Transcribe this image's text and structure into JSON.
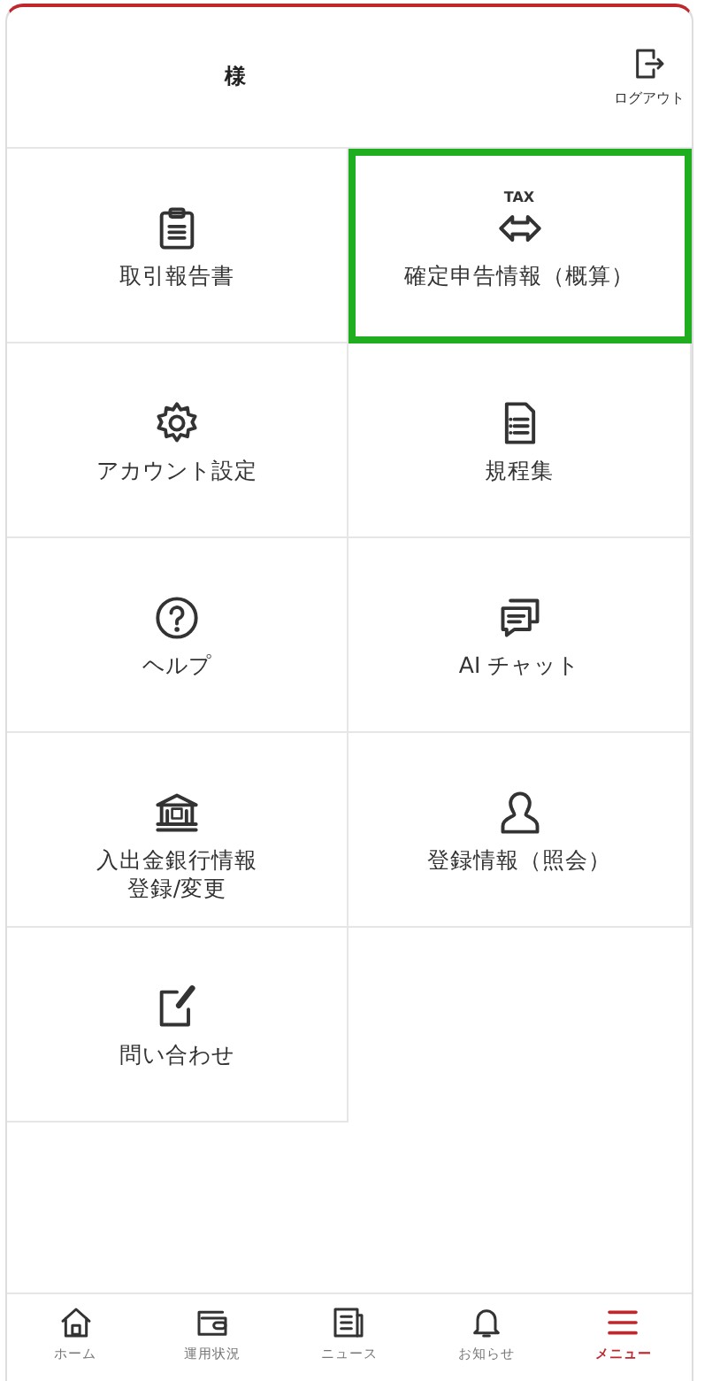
{
  "header": {
    "user_suffix": "様",
    "logout_label": "ログアウト"
  },
  "menu_rows": [
    [
      {
        "label": "取引報告書",
        "highlighted": false
      },
      {
        "label": "確定申告情報（概算）",
        "icon_text": "TAX",
        "highlighted": true
      }
    ],
    [
      {
        "label": "アカウント設定",
        "highlighted": false
      },
      {
        "label": "規程集",
        "highlighted": false
      }
    ],
    [
      {
        "label": "ヘルプ",
        "highlighted": false
      },
      {
        "label": "AI チャット",
        "highlighted": false
      }
    ],
    [
      {
        "label": "入出金銀行情報",
        "label_line_2": "登録/変更",
        "highlighted": false
      },
      {
        "label": "登録情報（照会）",
        "highlighted": false
      }
    ],
    [
      {
        "label": "問い合わせ",
        "highlighted": false
      }
    ]
  ],
  "bottom_nav": [
    {
      "label": "ホーム",
      "selected": false
    },
    {
      "label": "運用状況",
      "selected": false
    },
    {
      "label": "ニュース",
      "selected": false
    },
    {
      "label": "お知らせ",
      "selected": false
    },
    {
      "label": "メニュー",
      "selected": true
    }
  ]
}
